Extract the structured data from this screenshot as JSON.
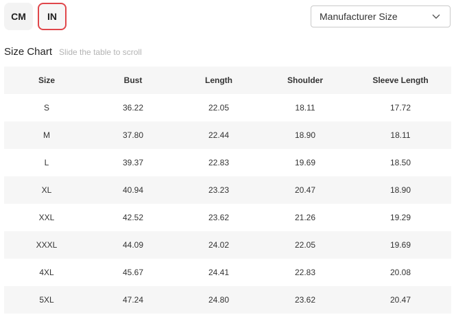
{
  "units": {
    "cm_label": "CM",
    "in_label": "IN",
    "selected": "IN"
  },
  "size_select": {
    "value": "Manufacturer Size",
    "icon": "chevron-down-icon"
  },
  "size_chart": {
    "title": "Size Chart",
    "hint": "Slide the table to scroll",
    "columns": [
      "Size",
      "Bust",
      "Length",
      "Shoulder",
      "Sleeve Length"
    ],
    "rows": [
      [
        "S",
        "36.22",
        "22.05",
        "18.11",
        "17.72"
      ],
      [
        "M",
        "37.80",
        "22.44",
        "18.90",
        "18.11"
      ],
      [
        "L",
        "39.37",
        "22.83",
        "19.69",
        "18.50"
      ],
      [
        "XL",
        "40.94",
        "23.23",
        "20.47",
        "18.90"
      ],
      [
        "XXL",
        "42.52",
        "23.62",
        "21.26",
        "19.29"
      ],
      [
        "XXXL",
        "44.09",
        "24.02",
        "22.05",
        "19.69"
      ],
      [
        "4XL",
        "45.67",
        "24.41",
        "22.83",
        "20.08"
      ],
      [
        "5XL",
        "47.24",
        "24.80",
        "23.62",
        "20.47"
      ]
    ]
  },
  "colors": {
    "accent_border": "#e0464a",
    "stripe": "#f6f6f6"
  }
}
